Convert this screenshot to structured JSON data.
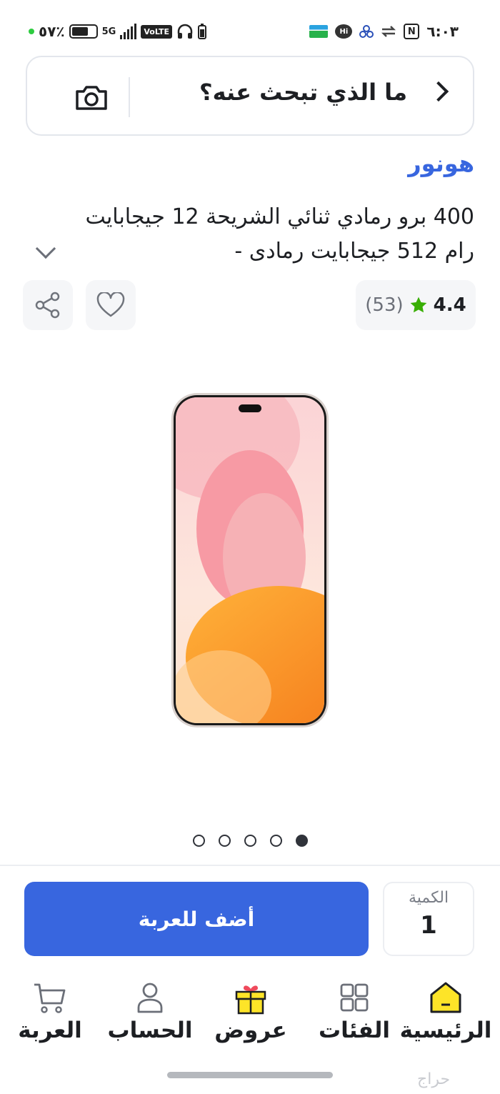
{
  "status_bar": {
    "battery": "٥٧٪",
    "network": "5G",
    "volte": "VoLTE",
    "time": "٦:٠٣",
    "hi_badge": "Hi"
  },
  "search": {
    "placeholder": "ما الذي تبحث عنه؟",
    "camera_icon": "camera-icon",
    "back_icon": "chevron-right-icon"
  },
  "product": {
    "brand": "هونور",
    "title": "400 برو رمادي ثنائي الشريحة 12 جيجابايت رام 512 جيجابايت رمادى -",
    "rating_value": "4.4",
    "rating_count": "(53)",
    "star_color": "#38ae04",
    "image_count": 5,
    "active_image_index": 4
  },
  "actions": {
    "add_to_cart": "أضف للعربة",
    "quantity_label": "الكمية",
    "quantity_value": "1",
    "accent": "#3866df"
  },
  "nav": {
    "items": [
      {
        "label": "الرئيسية",
        "icon": "home-icon"
      },
      {
        "label": "الفئات",
        "icon": "categories-icon"
      },
      {
        "label": "عروض",
        "icon": "gift-box-icon"
      },
      {
        "label": "الحساب",
        "icon": "user-icon"
      },
      {
        "label": "العربة",
        "icon": "cart-icon"
      }
    ]
  },
  "watermark": "حراج"
}
